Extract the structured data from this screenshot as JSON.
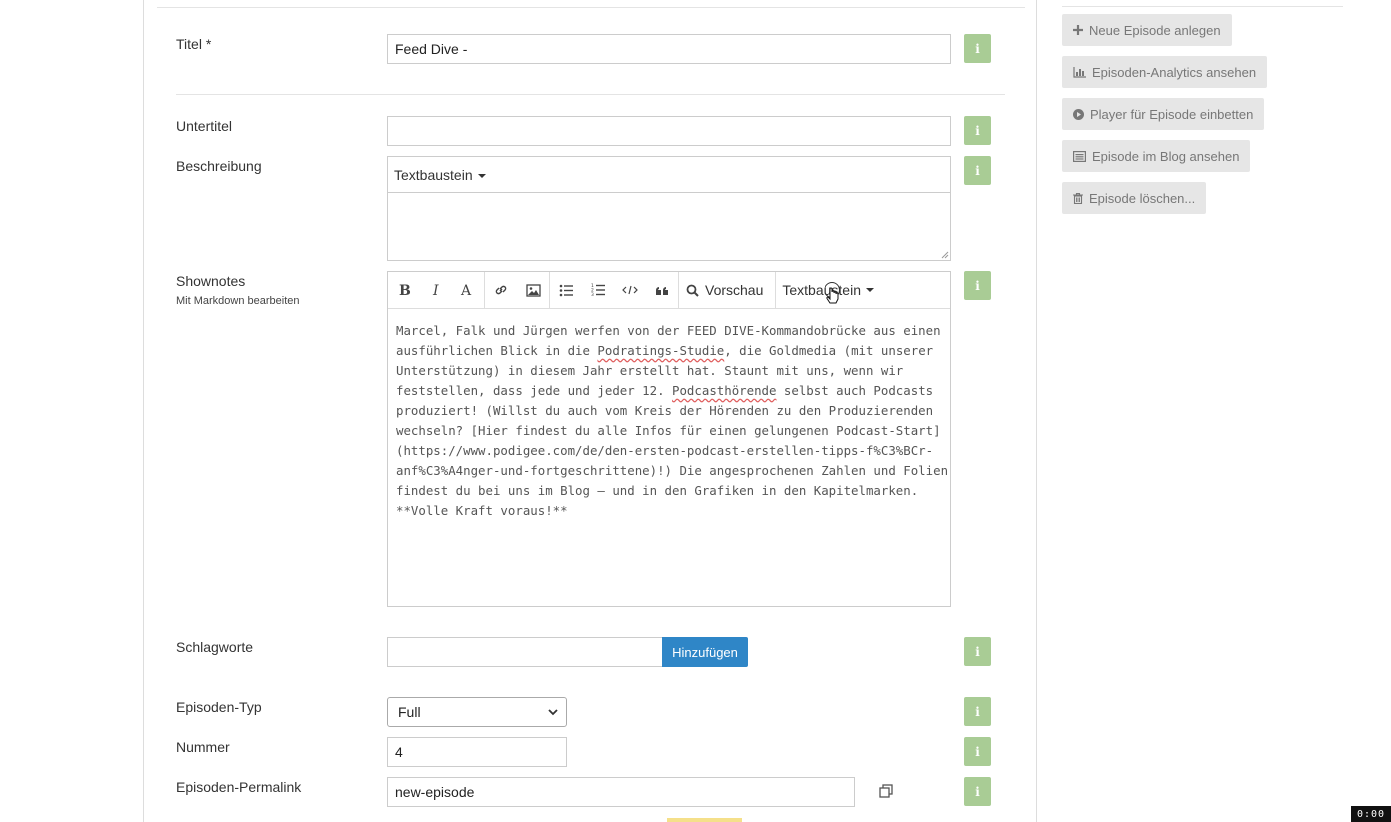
{
  "form": {
    "title_label": "Titel *",
    "title_value": "Feed Dive -",
    "subtitle_label": "Untertitel",
    "subtitle_value": "",
    "description_label": "Beschreibung",
    "description_snippet_btn": "Textbaustein",
    "shownotes_label": "Shownotes",
    "shownotes_sublabel": "Mit Markdown bearbeiten",
    "shownotes_toolbar": {
      "preview_label": "Vorschau",
      "snippet_label": "Textbaustein"
    },
    "shownotes_lines": [
      "Marcel, Falk und Jürgen werfen von der FEED DIVE-Kommandobrücke aus einen",
      "ausführlichen Blick in die ",
      "Podratings-Studie",
      ", die Goldmedia (mit unserer",
      "Unterstützung) in diesem Jahr erstellt hat. Staunt mit uns, wenn wir",
      "feststellen, dass jede und jeder 12. ",
      "Podcasthörende",
      " selbst auch Podcasts",
      "produziert! (Willst du auch vom Kreis der Hörenden zu den Produzierenden",
      "wechseln? [Hier findest du alle Infos für einen gelungenen Podcast-Start]",
      "(https://www.podigee.com/de/den-ersten-podcast-erstellen-tipps-f%C3%BCr-",
      "anf%C3%A4nger-und-fortgeschrittene)!) Die angesprochenen Zahlen und Folien",
      "findest du bei uns im Blog – und in den Grafiken in den Kapitelmarken.",
      "**Volle Kraft voraus!**"
    ],
    "tags_label": "Schlagworte",
    "tags_input_value": "",
    "tags_add_btn": "Hinzufügen",
    "episode_type_label": "Episoden-Typ",
    "episode_type_value": "Full",
    "number_label": "Nummer",
    "number_value": "4",
    "permalink_label": "Episoden-Permalink",
    "permalink_value": "new-episode",
    "info_glyph": "i"
  },
  "sidebar": {
    "buttons": [
      {
        "label": "Neue Episode anlegen",
        "icon": "plus-icon"
      },
      {
        "label": "Episoden-Analytics ansehen",
        "icon": "bar-chart-icon"
      },
      {
        "label": "Player für Episode einbetten",
        "icon": "play-circle-icon"
      },
      {
        "label": "Episode im Blog ansehen",
        "icon": "list-alt-icon"
      },
      {
        "label": "Episode löschen...",
        "icon": "trash-icon"
      }
    ]
  },
  "timer": "0:00",
  "colors": {
    "info_button": "#a9cc95",
    "primary_button": "#2f86c7",
    "sidebar_button": "#e6e6e6"
  }
}
